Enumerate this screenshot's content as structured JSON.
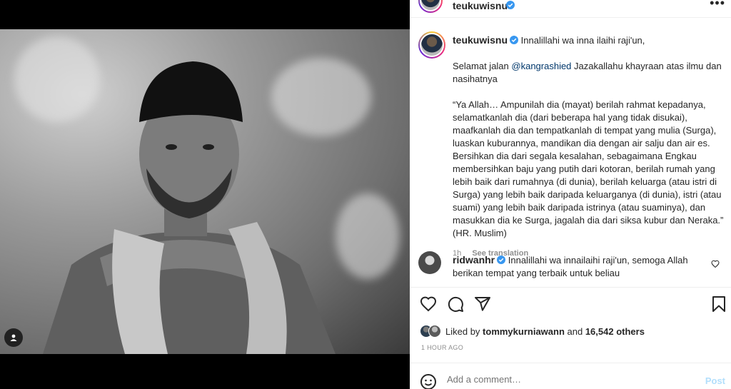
{
  "post": {
    "username": "teukuwisnu",
    "more_icon": "more-horizontal-icon"
  },
  "caption": {
    "username": "teukuwisnu",
    "line1": "Innalillahi wa inna ilaihi raji'un,",
    "para2_pre": "Selamat jalan ",
    "mention": "@kangrashied",
    "para2_post": " Jazakallahu khayraan atas ilmu dan nasihatnya",
    "para3": "“Ya Allah… Ampunilah dia (mayat) berilah rahmat kepadanya, selamatkanlah dia (dari beberapa hal yang tidak disukai), maafkanlah dia dan tempatkanlah di tempat yang mulia (Surga), luaskan kuburannya, mandikan dia dengan air salju dan air es. Bersihkan dia dari segala kesalahan, sebagaimana Engkau membersihkan baju yang putih dari kotoran, berilah rumah yang lebih baik dari rumahnya (di dunia), berilah keluarga (atau istri di Surga) yang lebih baik daripada keluarganya (di dunia), istri (atau suami) yang lebih baik daripada istrinya (atau suaminya), dan masukkan dia ke Surga, jagalah dia dari siksa kubur dan Neraka.” (HR. Muslim)",
    "age": "1h",
    "see_translation": "See translation"
  },
  "comment": {
    "username": "ridwanhr",
    "text": "Innalillahi wa innailaihi raji'un, semoga Allah berikan tempat yang terbaik untuk beliau"
  },
  "likes": {
    "prefix": "Liked by ",
    "user": "tommykurniawann",
    "mid": " and ",
    "count": "16,542 others"
  },
  "timestamp": "1 HOUR AGO",
  "add_comment": {
    "placeholder": "Add a comment…",
    "post_label": "Post"
  },
  "colors": {
    "verified": "#3897f0",
    "mention": "#00376b",
    "muted": "#8e8e8e",
    "post_disabled": "#b2dffc"
  }
}
